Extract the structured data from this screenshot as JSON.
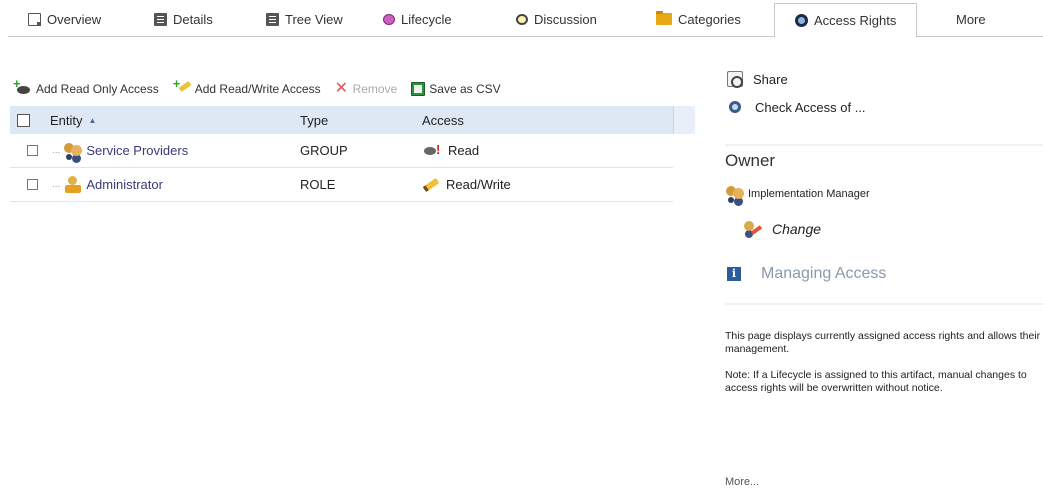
{
  "tabs": [
    {
      "label": "Overview",
      "icon": "overview-icon"
    },
    {
      "label": "Details",
      "icon": "details-icon"
    },
    {
      "label": "Tree View",
      "icon": "tree-view-icon"
    },
    {
      "label": "Lifecycle",
      "icon": "lifecycle-icon"
    },
    {
      "label": "Discussion",
      "icon": "discussion-icon"
    },
    {
      "label": "Categories",
      "icon": "folder-icon"
    },
    {
      "label": "Access Rights",
      "icon": "shield-icon",
      "active": true
    },
    {
      "label": "More"
    }
  ],
  "toolbar": {
    "add_read_only": "Add Read Only Access",
    "add_read_write": "Add Read/Write Access",
    "remove": "Remove",
    "save_csv": "Save as CSV"
  },
  "table": {
    "columns": {
      "entity": "Entity",
      "type": "Type",
      "access": "Access"
    },
    "sort": "ascending",
    "rows": [
      {
        "entity": "Service Providers",
        "entity_icon": "group-icon",
        "type": "GROUP",
        "access": "Read",
        "access_icon": "read-icon"
      },
      {
        "entity": "Administrator",
        "entity_icon": "role-icon",
        "type": "ROLE",
        "access": "Read/Write",
        "access_icon": "pencil-icon"
      }
    ]
  },
  "side": {
    "share": "Share",
    "check_access": "Check Access of ...",
    "owner_title": "Owner",
    "owner_name": "Implementation Manager",
    "change": "Change",
    "managing_title": "Managing Access",
    "desc1": "This page displays currently assigned access rights and allows their management.",
    "desc2": "Note: If a Lifecycle is assigned to this artifact, manual changes to access rights will be overwritten without notice.",
    "more": "More..."
  },
  "colors": {
    "header_bg": "#dde8f4",
    "link": "#3a3a7a",
    "remove_disabled": "#aaaaaa",
    "managing_title": "#8a9aac"
  }
}
